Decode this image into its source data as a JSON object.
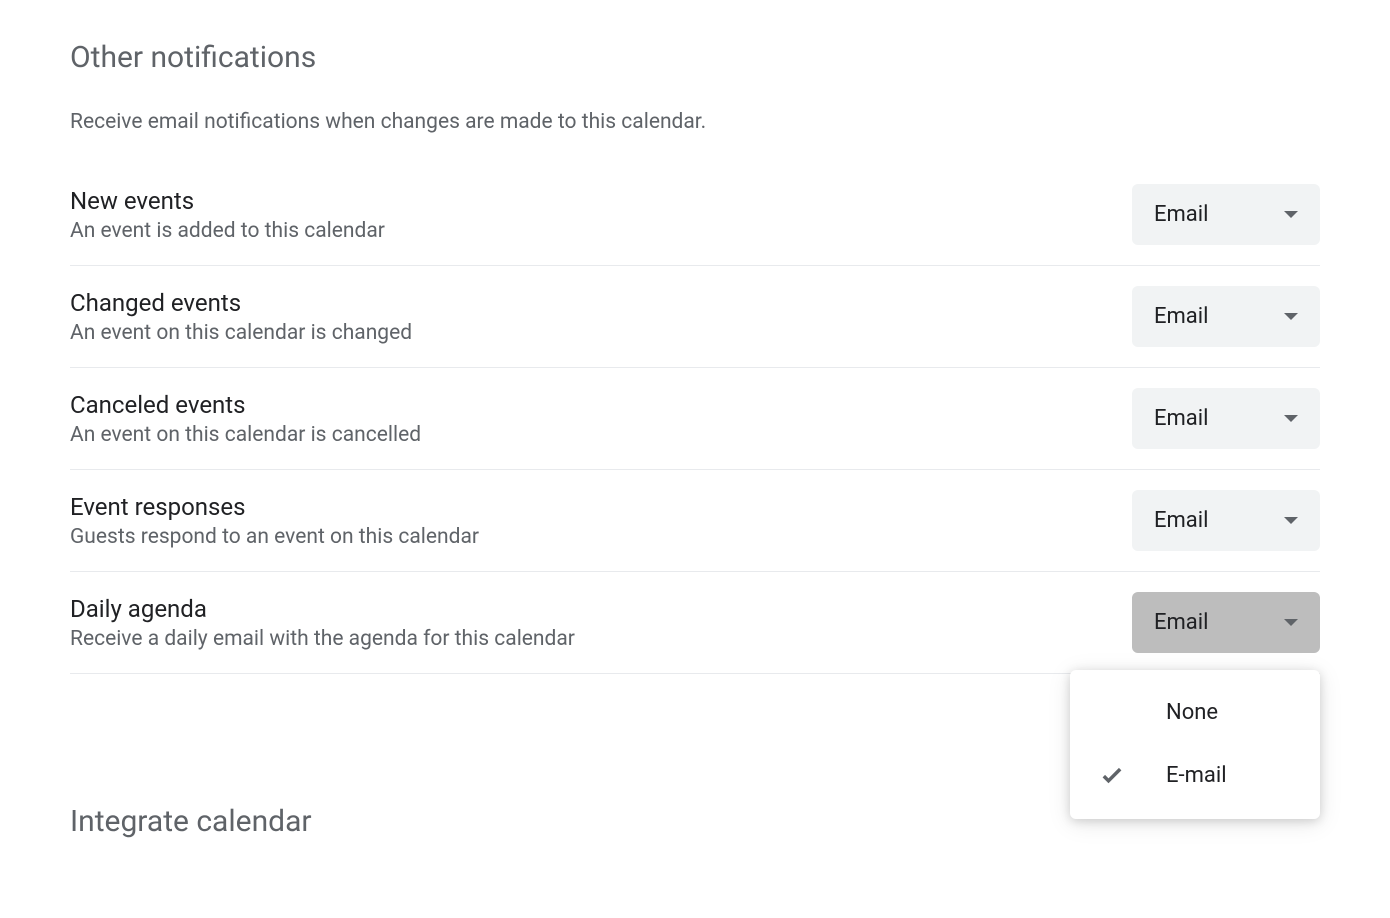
{
  "sections": {
    "other_notifications": {
      "title": "Other notifications",
      "description": "Receive email notifications when changes are made to this calendar.",
      "settings": [
        {
          "label": "New events",
          "sublabel": "An event is added to this calendar",
          "value": "Email"
        },
        {
          "label": "Changed events",
          "sublabel": "An event on this calendar is changed",
          "value": "Email"
        },
        {
          "label": "Canceled events",
          "sublabel": "An event on this calendar is cancelled",
          "value": "Email"
        },
        {
          "label": "Event responses",
          "sublabel": "Guests respond to an event on this calendar",
          "value": "Email"
        },
        {
          "label": "Daily agenda",
          "sublabel": "Receive a daily email with the agenda for this calendar",
          "value": "Email"
        }
      ]
    },
    "integrate_calendar": {
      "title": "Integrate calendar"
    }
  },
  "dropdown_menu": {
    "options": [
      {
        "label": "None",
        "selected": false
      },
      {
        "label": "E-mail",
        "selected": true
      }
    ]
  }
}
